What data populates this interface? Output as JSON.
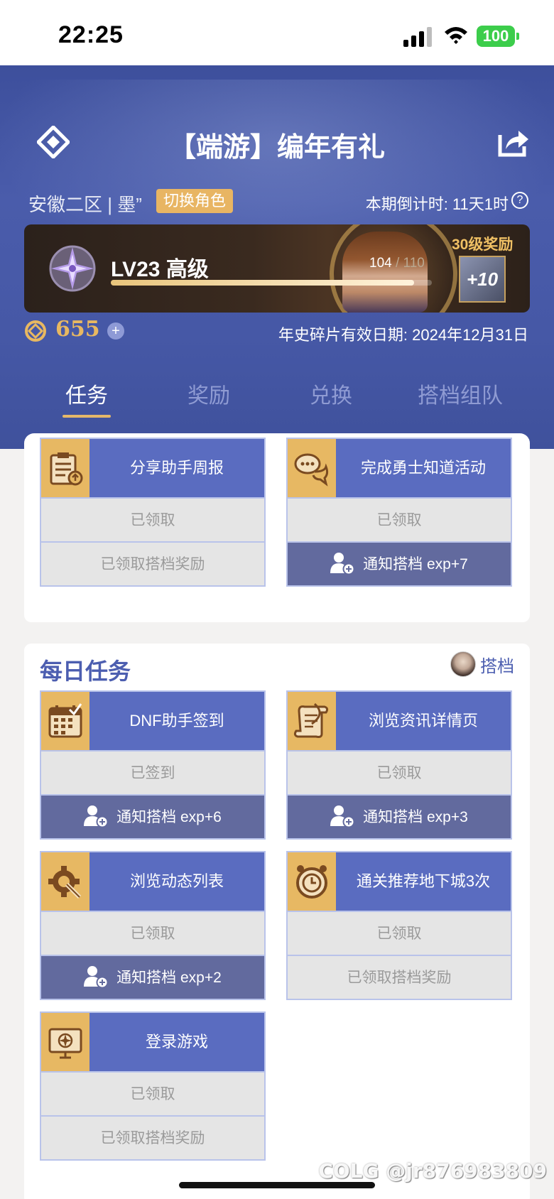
{
  "status_bar": {
    "time": "22:25",
    "battery": "100"
  },
  "header": {
    "title": "【端游】编年有礼",
    "server": "安徽二区 | 墨”",
    "switch_role": "切换角色",
    "countdown": "本期倒计时: 11天1时",
    "help_icon_text": "?",
    "level": {
      "label": "LV23 高级",
      "exp_current": "104",
      "exp_max": "/ 110",
      "exp_fraction": 0.945,
      "reward_label": "30级奖励",
      "reward_item_text": "+10"
    },
    "coins": "655",
    "coin_plus": "+",
    "expiry": "年史碎片有效日期: 2024年12月31日"
  },
  "tabs": [
    {
      "label": "任务",
      "active": true
    },
    {
      "label": "奖励",
      "active": false
    },
    {
      "label": "兑换",
      "active": false
    },
    {
      "label": "搭档组队",
      "active": false
    }
  ],
  "top_tasks": [
    {
      "name": "分享助手周报",
      "status": "已领取",
      "partner": "已领取搭档奖励",
      "partner_notify": false,
      "icon": "clipboard-icon"
    },
    {
      "name": "完成勇士知道活动",
      "status": "已领取",
      "partner": "通知搭档 exp+7",
      "partner_notify": true,
      "icon": "chat-bubbles-icon"
    }
  ],
  "daily": {
    "title": "每日任务",
    "partner_label": "搭档",
    "tasks": [
      {
        "name": "DNF助手签到",
        "status": "已签到",
        "partner": "通知搭档 exp+6",
        "partner_notify": true,
        "icon": "calendar-icon"
      },
      {
        "name": "浏览资讯详情页",
        "status": "已领取",
        "partner": "通知搭档 exp+3",
        "partner_notify": true,
        "icon": "scroll-icon"
      },
      {
        "name": "浏览动态列表",
        "status": "已领取",
        "partner": "通知搭档 exp+2",
        "partner_notify": true,
        "icon": "gear-wrench-icon"
      },
      {
        "name": "通关推荐地下城3次",
        "status": "已领取",
        "partner": "已领取搭档奖励",
        "partner_notify": false,
        "icon": "clock-icon"
      },
      {
        "name": "登录游戏",
        "status": "已领取",
        "partner": "已领取搭档奖励",
        "partner_notify": false,
        "icon": "monitor-icon"
      }
    ]
  },
  "watermark": "COLG @jr876983809",
  "colors": {
    "header_bg": "#4658a6",
    "task_head": "#5a6cc0",
    "icon_bg": "#e7b863",
    "notify_bg": "#626a9e",
    "gold": "#e8b861"
  }
}
